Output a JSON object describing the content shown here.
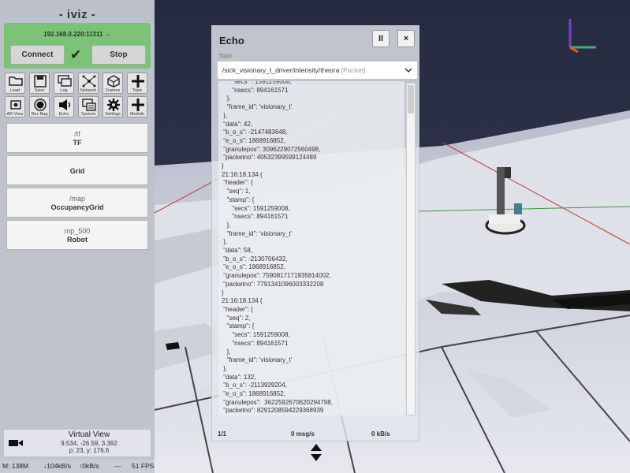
{
  "app": {
    "title": "- iviz -"
  },
  "connection": {
    "url": "192.168.0.220:11311 →",
    "connect_label": "Connect",
    "stop_label": "Stop",
    "status_icon": "check-icon",
    "color": "#7cc277"
  },
  "toolbar": {
    "row1": [
      {
        "label": "Load",
        "icon": "folder-icon"
      },
      {
        "label": "Save",
        "icon": "save-icon"
      },
      {
        "label": "Log",
        "icon": "log-icon"
      },
      {
        "label": "Network",
        "icon": "network-icon"
      },
      {
        "label": "Frames",
        "icon": "frames-icon"
      },
      {
        "label": "Topic",
        "icon": "plus-icon"
      }
    ],
    "row2": [
      {
        "label": "AR View",
        "icon": "ar-view-icon"
      },
      {
        "label": "Rec Bag",
        "icon": "record-icon"
      },
      {
        "label": "Echo",
        "icon": "echo-icon"
      },
      {
        "label": "System",
        "icon": "system-icon"
      },
      {
        "label": "Settings",
        "icon": "gear-icon"
      },
      {
        "label": "Module",
        "icon": "plus-icon"
      }
    ]
  },
  "modules": [
    {
      "topic": "/tf",
      "type": "TF"
    },
    {
      "topic": "",
      "type": "Grid"
    },
    {
      "topic": "/map",
      "type": "OccupancyGrid"
    },
    {
      "topic": "mp_500",
      "type": "Robot"
    }
  ],
  "virtual_view": {
    "title": "Virtual View",
    "position": "9.534, -26.59, 3.392",
    "rotation": "p: 23, y: 176.6"
  },
  "status_bar": {
    "memory": "M: 138M",
    "down": "↓104kB/s",
    "up": "↑0kB/s",
    "dashes": "---",
    "fps": "51 FPS"
  },
  "echo": {
    "title": "Echo",
    "pause_label": "II",
    "close_label": "×",
    "topic_label": "Topic",
    "topic_value": "/sick_visionary_t_driver/intensity/theora",
    "topic_type": "[Packet]",
    "lines": [
      "      \"secs\" : 1591259008,",
      "      \"nsecs\": 894161571",
      "   },",
      "   \"frame_id\": 'visionary_t'",
      " },",
      " \"data\": 42,",
      " \"b_o_s\": -2147483648,",
      " \"e_o_s\": 1868916852,",
      " \"granulepos\": 3096229072560498,",
      " \"packetno\": 40532399599124489",
      "}",
      "21:16:18.134 {",
      " \"header\": {",
      "   \"seq\": 1,",
      "   \"stamp\": {",
      "      \"secs\": 1591259008,",
      "      \"nsecs\": 894161571",
      "   },",
      "   \"frame_id\": 'visionary_t'",
      " },",
      " \"data\": 58,",
      " \"b_o_s\": -2130706432,",
      " \"e_o_s\": 1868916852,",
      " \"granulepos\": 7590817171935814002,",
      " \"packetno\": 7791341096003332208",
      "}",
      "21:16:18.134 {",
      " \"header\": {",
      "   \"seq\": 2,",
      "   \"stamp\": {",
      "      \"secs\": 1591259008,",
      "      \"nsecs\": 894161571",
      "   },",
      "   \"frame_id\": 'visionary_t'",
      " },",
      " \"data\": 132,",
      " \"b_o_s\": -2113929204,",
      " \"e_o_s\": 1868916852,",
      " \"granulepos\":  3622592670620294798,",
      " \"packetno\": 8291208594229368939",
      "}"
    ],
    "page": "1/1",
    "rate": "0 msg/s",
    "bandwidth": "0 kB/s"
  }
}
